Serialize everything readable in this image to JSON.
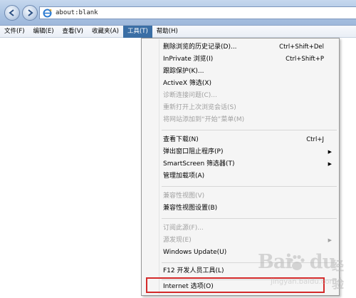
{
  "address": {
    "url": "about:blank"
  },
  "menubar": {
    "items": [
      {
        "label": "文件(F)"
      },
      {
        "label": "编辑(E)"
      },
      {
        "label": "查看(V)"
      },
      {
        "label": "收藏夹(A)"
      },
      {
        "label": "工具(T)"
      },
      {
        "label": "帮助(H)"
      }
    ]
  },
  "tools_menu": {
    "items": [
      {
        "label": "删除浏览的历史记录(D)...",
        "shortcut": "Ctrl+Shift+Del"
      },
      {
        "label": "InPrivate 浏览(I)",
        "shortcut": "Ctrl+Shift+P"
      },
      {
        "label": "跟踪保护(K)..."
      },
      {
        "label": "ActiveX 筛选(X)"
      },
      {
        "label": "诊断连接问题(C)..."
      },
      {
        "label": "重新打开上次浏览会话(S)"
      },
      {
        "label": "将网站添加到“开始”菜单(M)"
      },
      {
        "label": "查看下载(N)",
        "shortcut": "Ctrl+J"
      },
      {
        "label": "弹出窗口阻止程序(P)"
      },
      {
        "label": "SmartScreen 筛选器(T)"
      },
      {
        "label": "管理加载项(A)"
      },
      {
        "label": "兼容性视图(V)"
      },
      {
        "label": "兼容性视图设置(B)"
      },
      {
        "label": "订阅此源(F)..."
      },
      {
        "label": "源发现(E)"
      },
      {
        "label": "Windows Update(U)"
      },
      {
        "label": "F12 开发人员工具(L)"
      },
      {
        "label": "Internet 选项(O)"
      }
    ],
    "submenu_arrow": "▶"
  },
  "watermark": {
    "jingyan": "经验",
    "url": "jingyan.baidu.com"
  },
  "colors": {
    "highlight": "#d42a2a",
    "menubar_active": "#3a6ea5",
    "disabled_text": "#a0a0a0"
  }
}
